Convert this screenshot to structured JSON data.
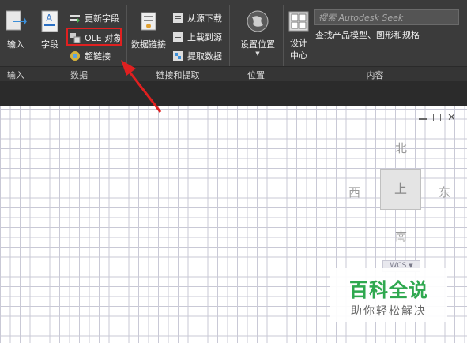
{
  "ribbon": {
    "import_button": "输入",
    "field_button": "字段",
    "update_fields": "更新字段",
    "ole_object": "OLE 对象",
    "hyperlink": "超链接",
    "data_link": "数据链接",
    "download_from_source": "从源下载",
    "upload_to_source": "上载到源",
    "extract_data": "提取数据",
    "set_location": "设置位置",
    "design_center_line1": "设计",
    "design_center_line2": "中心",
    "seek_placeholder": "搜索 Autodesk Seek",
    "seek_description": "查找产品模型、图形和规格",
    "panels": {
      "import": "输入",
      "data": "数据",
      "linking": "链接和提取",
      "location": "位置",
      "content": "内容"
    }
  },
  "viewcube": {
    "north": "北",
    "south": "南",
    "east": "东",
    "west": "西",
    "face": "上",
    "wcs": "WCS"
  },
  "watermark": {
    "title": "百科全说",
    "subtitle": "助你轻松解决"
  },
  "colors": {
    "ribbon_bg": "#3b3b3b",
    "highlight_red": "#e02020",
    "watermark_green": "#2fa84f"
  }
}
